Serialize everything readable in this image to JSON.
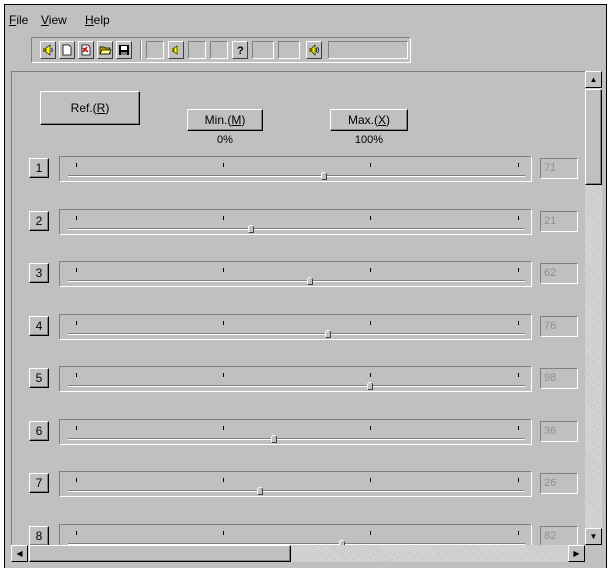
{
  "menu": {
    "file": {
      "key": "F",
      "rest": "ile"
    },
    "view": {
      "key": "V",
      "rest": "iew"
    },
    "help": {
      "key": "H",
      "rest": "elp"
    }
  },
  "toolbar": {
    "icons": [
      "speaker-icon",
      "new-document-icon",
      "new-red-document-icon",
      "open-folder-icon",
      "save-disk-icon",
      "speaker-small-icon",
      "question-help-icon",
      "speaker-sound-icon"
    ]
  },
  "controls": {
    "ref_label": "Ref.(",
    "ref_key": "R",
    "min_label": "Min.(",
    "min_key": "M",
    "max_label": "Max.(",
    "max_key": "X",
    "close_paren": ")",
    "min_value": "0%",
    "max_value": "100%"
  },
  "sliders": [
    {
      "label": "1",
      "value": "71",
      "position": 0.56
    },
    {
      "label": "2",
      "value": "21",
      "position": 0.4
    },
    {
      "label": "3",
      "value": "62",
      "position": 0.53
    },
    {
      "label": "4",
      "value": "76",
      "position": 0.57
    },
    {
      "label": "5",
      "value": "98",
      "position": 0.66
    },
    {
      "label": "6",
      "value": "36",
      "position": 0.45
    },
    {
      "label": "7",
      "value": "26",
      "position": 0.42
    },
    {
      "label": "8",
      "value": "82",
      "position": 0.6
    }
  ]
}
